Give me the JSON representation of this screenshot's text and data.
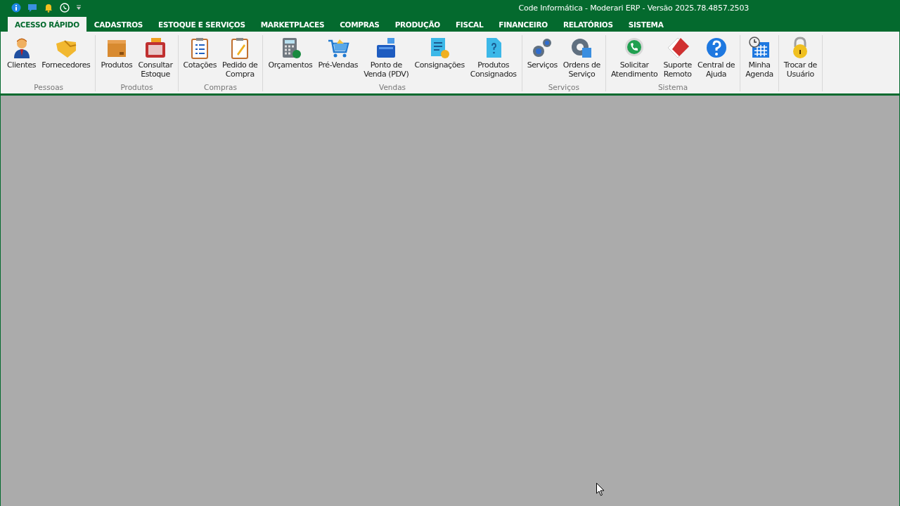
{
  "window": {
    "title": "Code Informática - Moderari ERP - Versão 2025.78.4857.2503"
  },
  "tabs": [
    {
      "label": "ACESSO RÁPIDO",
      "selected": true
    },
    {
      "label": "CADASTROS",
      "selected": false
    },
    {
      "label": "ESTOQUE E SERVIÇOS",
      "selected": false
    },
    {
      "label": "MARKETPLACES",
      "selected": false
    },
    {
      "label": "COMPRAS",
      "selected": false
    },
    {
      "label": "PRODUÇÃO",
      "selected": false
    },
    {
      "label": "FISCAL",
      "selected": false
    },
    {
      "label": "FINANCEIRO",
      "selected": false
    },
    {
      "label": "RELATÓRIOS",
      "selected": false
    },
    {
      "label": "SISTEMA",
      "selected": false
    }
  ],
  "ribbon_groups": [
    {
      "label": "Pessoas",
      "buttons": [
        "Clientes",
        "Fornecedores"
      ]
    },
    {
      "label": "Produtos",
      "buttons": [
        "Produtos",
        "Consultar\nEstoque"
      ]
    },
    {
      "label": "Compras",
      "buttons": [
        "Cotações",
        "Pedido de\nCompra"
      ]
    },
    {
      "label": "Vendas",
      "buttons": [
        "Orçamentos",
        "Pré-Vendas",
        "Ponto de\nVenda (PDV)",
        "Consignações",
        "Produtos\nConsignados"
      ]
    },
    {
      "label": "Serviços",
      "buttons": [
        "Serviços",
        "Ordens de\nServiço"
      ]
    },
    {
      "label": "Sistema",
      "buttons": [
        "Solicitar\nAtendimento",
        "Suporte\nRemoto",
        "Central de\nAjuda"
      ]
    },
    {
      "buttons": [
        "Minha\nAgenda"
      ]
    },
    {
      "buttons": [
        "Trocar de\nUsuário"
      ]
    }
  ]
}
